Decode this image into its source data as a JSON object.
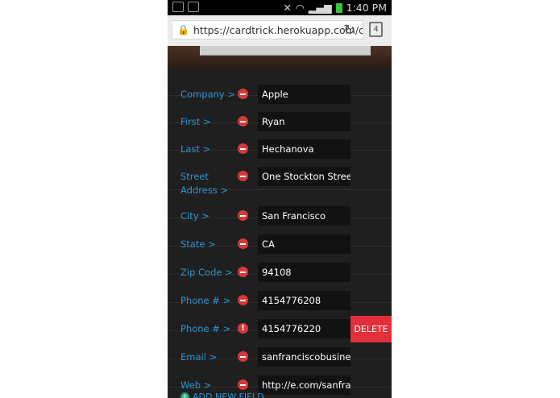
{
  "status_bar": {
    "time": "1:40 PM"
  },
  "browser": {
    "url": "https://cardtrick.herokuapp.com/cc",
    "tab_count": "4"
  },
  "fields": [
    {
      "label": "Company >",
      "value": "Apple"
    },
    {
      "label": "First >",
      "value": "Ryan"
    },
    {
      "label": "Last >",
      "value": "Hechanova"
    },
    {
      "label_lines": [
        "Street",
        "Address >"
      ],
      "value": "One Stockton Street \\"
    },
    {
      "label": "City >",
      "value": "San Francisco"
    },
    {
      "label": "State >",
      "value": "CA"
    },
    {
      "label": "Zip Code >",
      "value": "94108"
    },
    {
      "label": "Phone # >",
      "value": "4154776208"
    },
    {
      "label": "Phone # >",
      "value": "4154776220",
      "warning": true,
      "delete_label": "DELETE"
    },
    {
      "label": "Email >",
      "value": "sanfranciscobusiness"
    },
    {
      "label": "Web >",
      "value": "http://e.com/sanfranc"
    }
  ],
  "add_field_label": "ADD NEW FIELD",
  "colors": {
    "label": "#2e94cf",
    "remove": "#d43a3a",
    "delete_bg": "#e0303a",
    "panel_bg": "#1f1f1f",
    "field_bg": "#121212"
  }
}
